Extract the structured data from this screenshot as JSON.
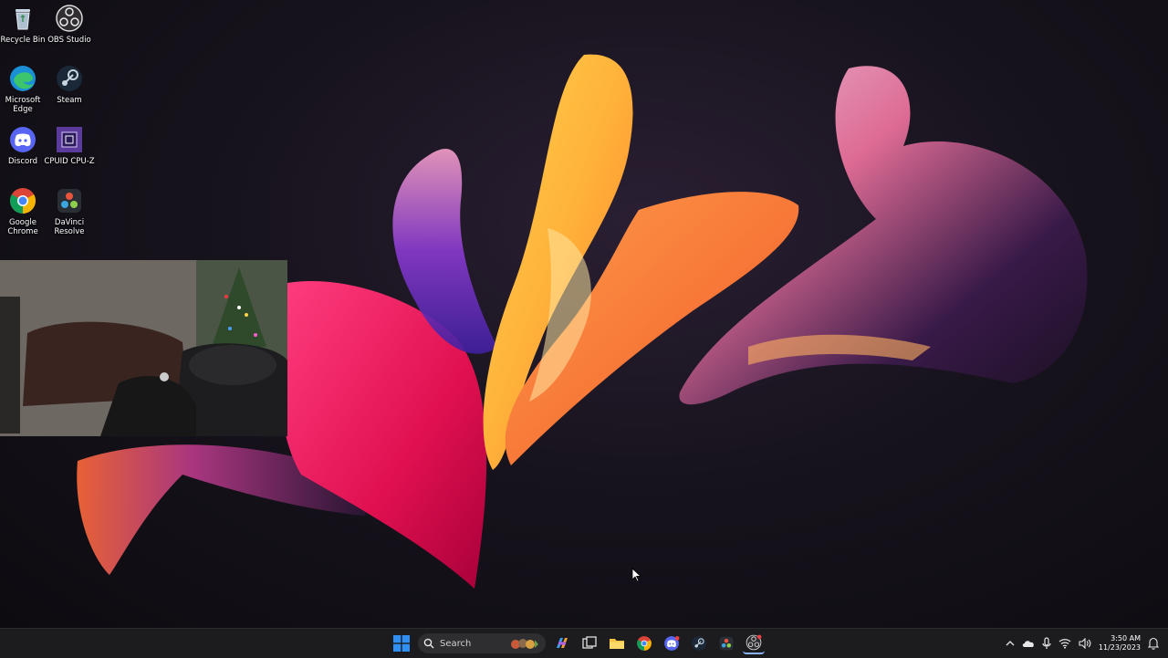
{
  "desktop": {
    "icons": [
      {
        "label": "Recycle Bin",
        "icon": "recycle-bin-icon"
      },
      {
        "label": "OBS Studio",
        "icon": "obs-icon"
      },
      {
        "label": "Microsoft Edge",
        "icon": "edge-icon"
      },
      {
        "label": "Steam",
        "icon": "steam-icon"
      },
      {
        "label": "Discord",
        "icon": "discord-icon"
      },
      {
        "label": "CPUID CPU-Z",
        "icon": "cpuz-icon"
      },
      {
        "label": "Google Chrome",
        "icon": "chrome-icon"
      },
      {
        "label": "DaVinci Resolve",
        "icon": "davinci-icon"
      }
    ]
  },
  "taskbar": {
    "search_placeholder": "Search",
    "apps": [
      "start-icon",
      "search",
      "copilot-icon",
      "task-view-icon",
      "file-explorer-icon",
      "chrome-icon",
      "discord-icon",
      "steam-icon",
      "davinci-icon",
      "obs-icon"
    ]
  },
  "tray": {
    "time": "3:50 AM",
    "date": "11/23/2023"
  },
  "colors": {
    "taskbar_bg": "#1c1c1e",
    "windows_blue": "#2f8ff5"
  }
}
